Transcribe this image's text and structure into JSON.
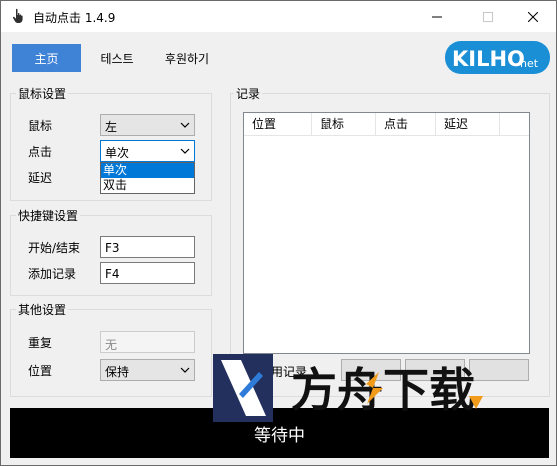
{
  "window": {
    "title": "自动点击 1.4.9",
    "minimize_icon": "minimize-icon",
    "maximize_icon": "maximize-icon",
    "close_icon": "close-icon"
  },
  "nav": {
    "tabs": [
      {
        "label": "主页",
        "active": true
      },
      {
        "label": "테스트",
        "active": false
      },
      {
        "label": "후원하기",
        "active": false
      }
    ]
  },
  "logo": {
    "text": "KILHO",
    "suffix": "net"
  },
  "mouse_settings": {
    "title": "鼠标设置",
    "mouse_label": "鼠标",
    "mouse_value": "左",
    "click_label": "点击",
    "click_value": "单次",
    "delay_label": "延迟",
    "click_options": [
      "单次",
      "双击"
    ],
    "click_selected": "单次"
  },
  "hotkey_settings": {
    "title": "快捷键设置",
    "start_stop_label": "开始/结束",
    "start_stop_value": "F3",
    "add_record_label": "添加记录",
    "add_record_value": "F4"
  },
  "other_settings": {
    "title": "其他设置",
    "repeat_label": "重复",
    "repeat_value": "无",
    "position_label": "位置",
    "position_value": "保持"
  },
  "records": {
    "title": "记录",
    "columns": [
      "位置",
      "鼠标",
      "点击",
      "延迟"
    ],
    "use_record_label": "用记录"
  },
  "status": {
    "text": "等待中"
  },
  "watermark": {
    "text": "方舟下载"
  },
  "colors": {
    "accent": "#3f83d6",
    "selection": "#0078d7",
    "status_bg": "#000000",
    "logo_blue": "#1b8fd6"
  }
}
